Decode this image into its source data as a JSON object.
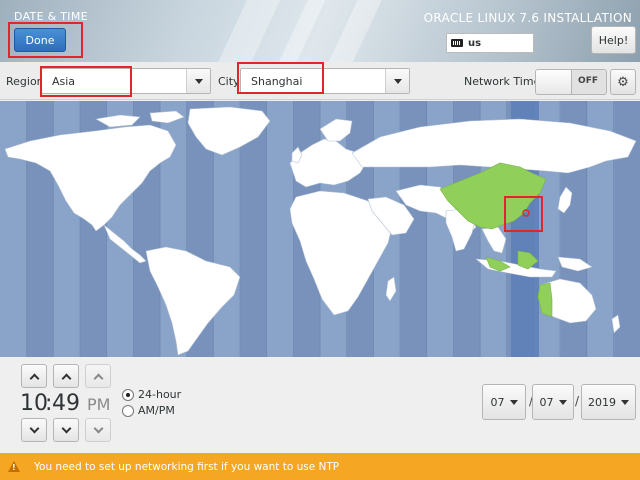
{
  "header": {
    "screen_title": "DATE & TIME",
    "product_title": "ORACLE LINUX 7.6 INSTALLATION",
    "done_label": "Done",
    "keyboard_layout": "us",
    "help_label": "Help!"
  },
  "toolbar": {
    "region_label": "Region",
    "region_value": "Asia",
    "city_label": "City",
    "city_value": "Shanghai",
    "network_time_label": "Network Time",
    "network_time_state": "OFF"
  },
  "map": {
    "ocean_color": "#7d98c0",
    "land_color": "#ffffff",
    "highlight_color": "#8fcf5a",
    "selected_timezone_band": "UTC+8",
    "selected_city": "Shanghai"
  },
  "time": {
    "hours": "10",
    "separator": ":",
    "minutes": "49",
    "ampm": "PM",
    "format_24_label": "24-hour",
    "format_ampm_label": "AM/PM",
    "selected_format": "24-hour"
  },
  "date": {
    "month": "07",
    "day": "07",
    "year": "2019",
    "separator": "/"
  },
  "warning": {
    "message": "You need to set up networking first if you want to use NTP"
  }
}
